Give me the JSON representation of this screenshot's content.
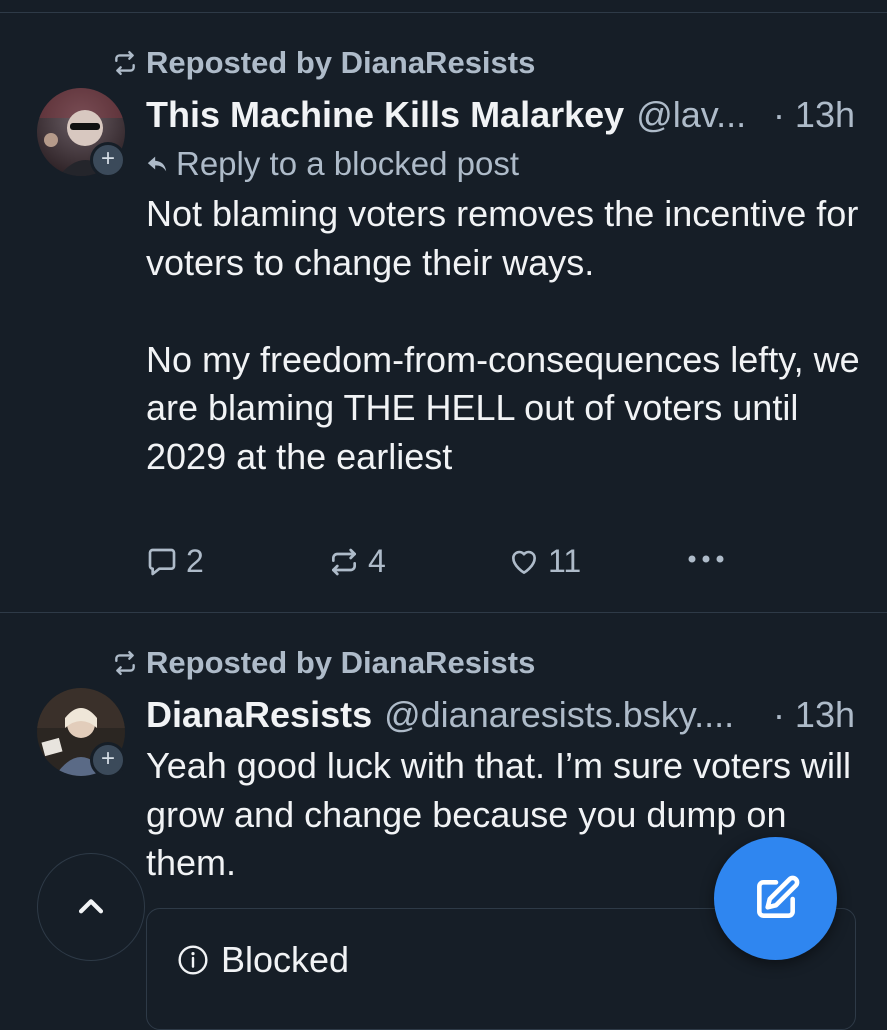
{
  "posts": [
    {
      "repost_label": "Reposted by DianaResists",
      "author_name": "This Machine Kills Malarkey",
      "handle": "@lav...",
      "time": "· 13h",
      "reply_label": "Reply to a blocked post",
      "text": "Not blaming voters removes the incentive for voters to change their ways.\n\nNo my freedom-from-consequences lefty, we are blaming THE HELL out of voters until 2029 at the earliest",
      "reply_count": "2",
      "repost_count": "4",
      "like_count": "11",
      "avatar_icon": "avatar-photo",
      "follow_icon": "plus-icon"
    },
    {
      "repost_label": "Reposted by DianaResists",
      "author_name": "DianaResists",
      "handle": "@dianaresists.bsky....",
      "time": "· 13h",
      "text": "Yeah good luck with that. I’m sure voters will grow and change because you dump on them.",
      "avatar_icon": "avatar-photo",
      "follow_icon": "plus-icon",
      "quote": {
        "blocked_label": "Blocked",
        "icon": "info-icon"
      }
    }
  ],
  "fabs": {
    "scroll_top_icon": "chevron-up-icon",
    "compose_icon": "compose-icon"
  },
  "colors": {
    "background": "#161e27",
    "text": "#f1f3f5",
    "muted": "#aebbc9",
    "accent": "#2f86f0",
    "border": "#2e3a47"
  }
}
